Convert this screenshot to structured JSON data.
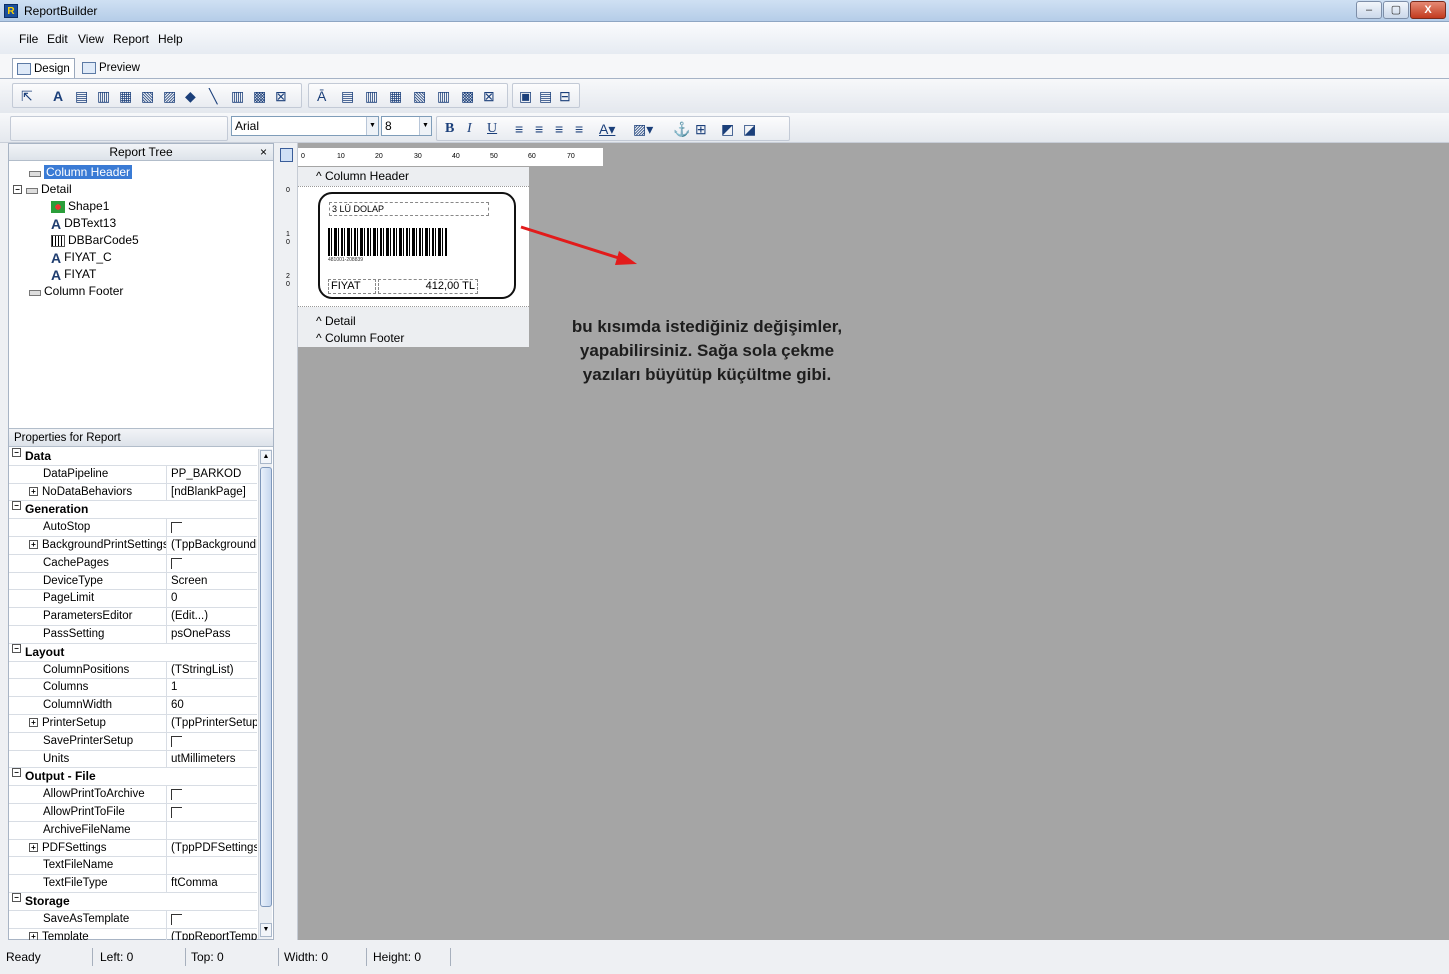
{
  "window": {
    "title": "ReportBuilder",
    "logo": "R",
    "buttons": {
      "minimize": "–",
      "maximize": "▢",
      "close": "X"
    }
  },
  "menu": [
    "File",
    "Edit",
    "View",
    "Report",
    "Help"
  ],
  "tabs": {
    "design": "Design",
    "preview": "Preview"
  },
  "toolbar": {
    "font": "Arial",
    "size": "8"
  },
  "tree": {
    "title": "Report Tree",
    "close": "×",
    "nodes": [
      "Column Header",
      "Detail",
      "Shape1",
      "DBText13",
      "DBBarCode5",
      "FIYAT_C",
      "FIYAT",
      "Column Footer"
    ]
  },
  "properties": {
    "title": "Properties for Report",
    "rows": [
      {
        "t": "cat",
        "name": "Data"
      },
      {
        "name": "DataPipeline",
        "value": "PP_BARKOD"
      },
      {
        "name": "NoDataBehaviors",
        "value": "[ndBlankPage]",
        "exp": true
      },
      {
        "t": "cat",
        "name": "Generation"
      },
      {
        "name": "AutoStop",
        "value": "",
        "cb": true
      },
      {
        "name": "BackgroundPrintSettings",
        "value": "(TppBackgroundP",
        "exp": true
      },
      {
        "name": "CachePages",
        "value": "",
        "cb": true
      },
      {
        "name": "DeviceType",
        "value": "Screen"
      },
      {
        "name": "PageLimit",
        "value": "0"
      },
      {
        "name": "ParametersEditor",
        "value": "(Edit...)"
      },
      {
        "name": "PassSetting",
        "value": "psOnePass"
      },
      {
        "t": "cat",
        "name": "Layout"
      },
      {
        "name": "ColumnPositions",
        "value": "(TStringList)"
      },
      {
        "name": "Columns",
        "value": "1"
      },
      {
        "name": "ColumnWidth",
        "value": "60"
      },
      {
        "name": "PrinterSetup",
        "value": "(TppPrinterSetup)",
        "exp": true
      },
      {
        "name": "SavePrinterSetup",
        "value": "",
        "cb": true
      },
      {
        "name": "Units",
        "value": "utMillimeters"
      },
      {
        "t": "cat",
        "name": "Output - File"
      },
      {
        "name": "AllowPrintToArchive",
        "value": "",
        "cb": true
      },
      {
        "name": "AllowPrintToFile",
        "value": "",
        "cb": true
      },
      {
        "name": "ArchiveFileName",
        "value": ""
      },
      {
        "name": "PDFSettings",
        "value": "(TppPDFSettings)",
        "exp": true
      },
      {
        "name": "TextFileName",
        "value": ""
      },
      {
        "name": "TextFileType",
        "value": "ftComma"
      },
      {
        "t": "cat",
        "name": "Storage"
      },
      {
        "name": "SaveAsTemplate",
        "value": "",
        "cb": true
      },
      {
        "name": "Template",
        "value": "(TppReportTemplate",
        "exp": true
      }
    ]
  },
  "ruler": {
    "top": [
      "0",
      "10",
      "20",
      "30",
      "40",
      "50",
      "60",
      "70"
    ],
    "left": [
      "0",
      "1\n0",
      "2\n0"
    ]
  },
  "bands": {
    "header": "Column Header",
    "detail": "Detail",
    "footer": "Column Footer"
  },
  "label": {
    "name": "3 LÜ DOLAP",
    "barcode_number": "481001-208839",
    "price_label": "FIYAT",
    "price_value": "412,00 TL"
  },
  "annotation": [
    "bu kısımda istediğiniz değişimler,",
    "yapabilirsiniz. Sağa sola çekme",
    "yazıları büyütüp küçültme gibi."
  ],
  "status": {
    "ready": "Ready",
    "left": "Left: 0",
    "top": "Top: 0",
    "width": "Width: 0",
    "height": "Height: 0"
  },
  "colors": {
    "arrow": "#e21b1b",
    "workspace": "#a5a5a5",
    "selection": "#3a7bd5"
  }
}
